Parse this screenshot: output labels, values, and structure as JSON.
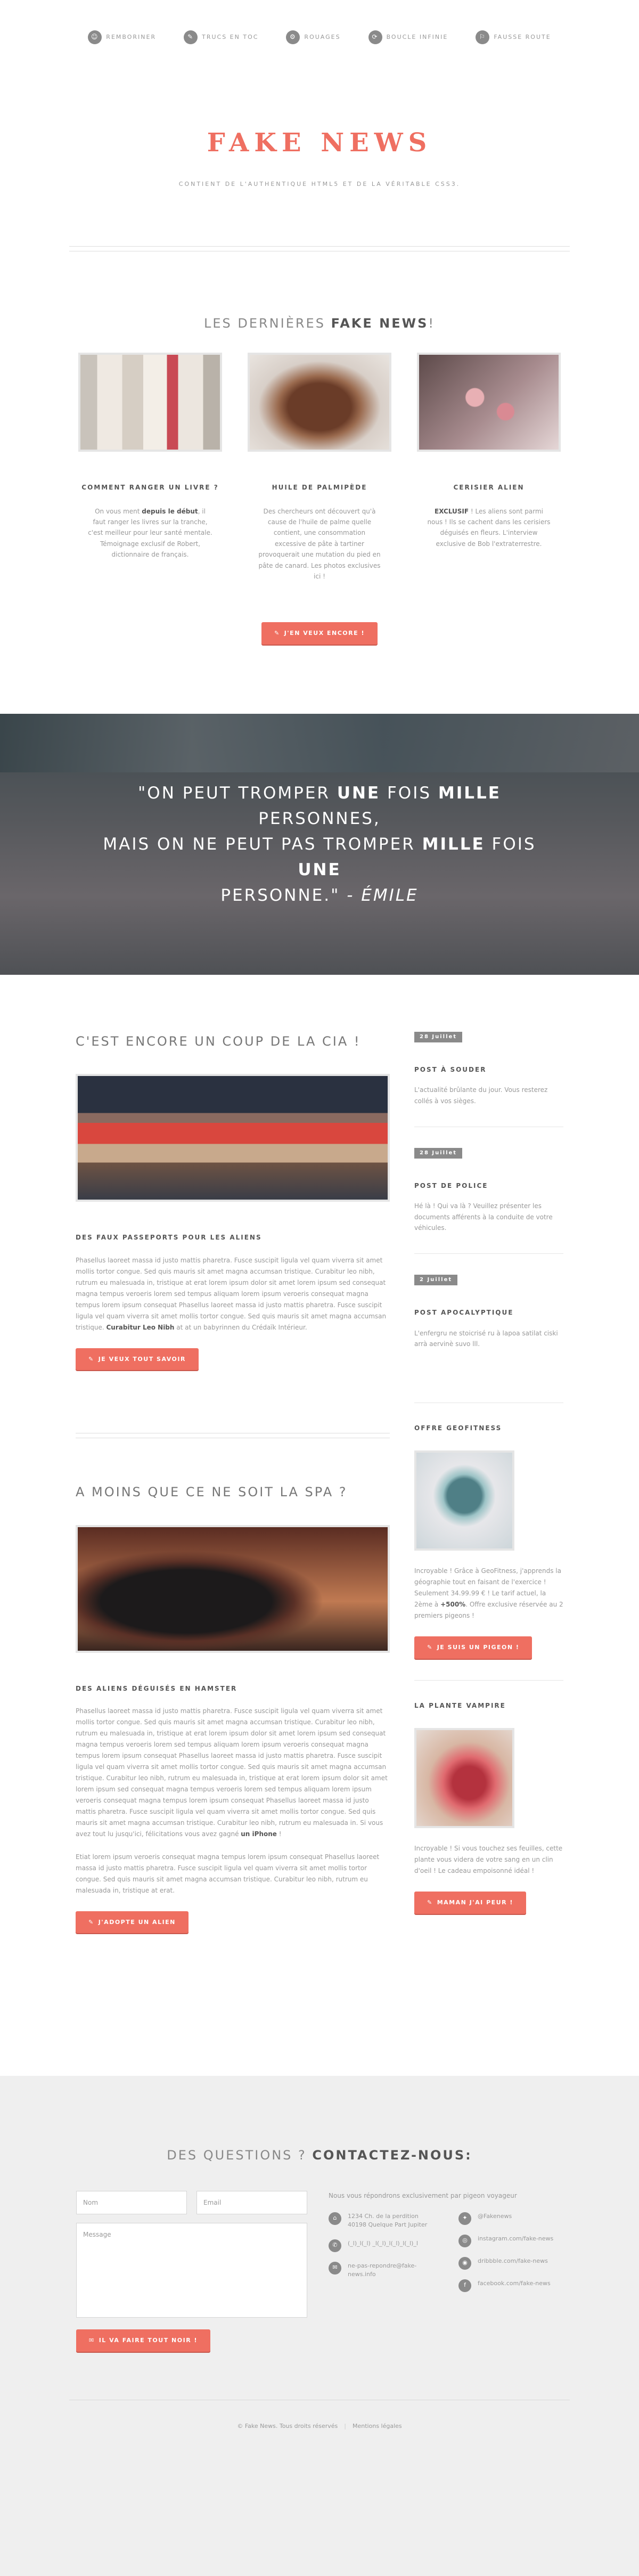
{
  "nav": {
    "items": [
      {
        "label": "Remboriner",
        "icon": "☺"
      },
      {
        "label": "Trucs en toc",
        "icon": "✎"
      },
      {
        "label": "Rouages",
        "icon": "⚙"
      },
      {
        "label": "Boucle infinie",
        "icon": "⟳"
      },
      {
        "label": "Fausse route",
        "icon": "⚐"
      }
    ]
  },
  "hero": {
    "title": "FAKE NEWS",
    "subtitle": "Contient de l'authentique HTML5 et de la véritable CSS3."
  },
  "news": {
    "title_a": "Les dernières",
    "title_b": "Fake News",
    "title_c": "!",
    "cards": [
      {
        "title": "Comment ranger un livre ?",
        "text_a": "On vous ment ",
        "text_b": "depuis le début",
        "text_c": ", il faut ranger les livres sur la tranche, c'est meilleur pour leur santé mentale. Témoignage exclusif de Robert, dictionnaire de français."
      },
      {
        "title": "Huile de palmipède",
        "text_a": "Des chercheurs ont découvert qu'à cause de l'huile de palme quelle contient, une consommation excessive de pâte à tartiner provoquerait une mutation du pied en pâte de canard. Les photos exclusives ici !",
        "text_b": "",
        "text_c": ""
      },
      {
        "title": "Cerisier alien",
        "text_a": "",
        "text_b": "EXCLUSIF",
        "text_c": " ! Les aliens sont parmi nous ! Ils se cachent dans les cerisiers déguisés en fleurs. L'interview exclusive de Bob l'extraterrestre."
      }
    ],
    "button": "J'en veux encore !",
    "button_icon": "✎"
  },
  "quote": {
    "l1a": "\"On peut tromper ",
    "l1b": "une",
    "l1c": " fois ",
    "l1d": "mille",
    "l1e": " personnes,",
    "l2a": "mais on ne peut pas tromper ",
    "l2b": "mille",
    "l2c": " fois ",
    "l2d": "une",
    "l3a": "personne.\"",
    "l3b": " - Émile"
  },
  "article1": {
    "title": "C'est encore un coup de la CIA !",
    "subhead": "Des faux passeports pour les aliens",
    "body_a": "Phasellus laoreet massa id justo mattis pharetra. Fusce suscipit ligula vel quam viverra sit amet mollis tortor congue. Sed quis mauris sit amet magna accumsan tristique. Curabitur leo nibh, rutrum eu malesuada in, tristique at erat lorem ipsum dolor sit amet lorem ipsum sed consequat magna tempus veroeris lorem sed tempus aliquam lorem ipsum veroeris consequat magna tempus lorem ipsum consequat Phasellus laoreet massa id justo mattis pharetra. Fusce suscipit ligula vel quam viverra sit amet mollis tortor congue. Sed quis mauris sit amet magna accumsan tristique. ",
    "body_b": "Curabitur Leo Nibh",
    "body_c": " at at un babyrinnen du Crédaïk Intérieur.",
    "button": "Je veux tout savoir",
    "button_icon": "✎"
  },
  "article2": {
    "title": "A moins que ce ne soit la SPA ?",
    "subhead": "Des aliens déguisés en hamster",
    "body_a": "Phasellus laoreet massa id justo mattis pharetra. Fusce suscipit ligula vel quam viverra sit amet mollis tortor congue. Sed quis mauris sit amet magna accumsan tristique. Curabitur leo nibh, rutrum eu malesuada in, tristique at erat lorem ipsum dolor sit amet lorem ipsum sed consequat magna tempus veroeris lorem sed tempus aliquam lorem ipsum veroeris consequat magna tempus lorem ipsum consequat Phasellus laoreet massa id justo mattis pharetra. Fusce suscipit ligula vel quam viverra sit amet mollis tortor congue. Sed quis mauris sit amet magna accumsan tristique. Curabitur leo nibh, rutrum eu malesuada in, tristique at erat lorem ipsum dolor sit amet lorem ipsum sed consequat magna tempus veroeris lorem sed tempus aliquam lorem ipsum veroeris consequat magna tempus lorem ipsum consequat Phasellus laoreet massa id justo mattis pharetra. Fusce suscipit ligula vel quam viverra sit amet mollis tortor congue. Sed quis mauris sit amet magna accumsan tristique. Curabitur leo nibh, rutrum eu malesuada in. Si vous avez tout lu jusqu'ici, félicitations vous avez gagné ",
    "body_b": "un iPhone",
    "body_c": " !",
    "body2": "Etiat lorem ipsum veroeris consequat magna tempus lorem ipsum consequat Phasellus laoreet massa id justo mattis pharetra. Fusce suscipit ligula vel quam viverra sit amet mollis tortor congue. Sed quis mauris sit amet magna accumsan tristique. Curabitur leo nibh, rutrum eu malesuada in, tristique at erat.",
    "button": "J'adopte un alien",
    "button_icon": "✎"
  },
  "sidebar": {
    "posts": [
      {
        "date": "28 Juillet",
        "title": "Post à souder",
        "text": "L'actualité brûlante du jour. Vous resterez collés à vos sièges."
      },
      {
        "date": "28 Juillet",
        "title": "Post de police",
        "text": "Hé là ! Qui va là ? Veuillez présenter les documents afférents à la conduite de votre véhicules."
      },
      {
        "date": "2 Juillet",
        "title": "Post apocalyptique",
        "text": "L'enfergru ne stoicrisé ru à lapoa satilat ciski arrà aervinè suvo lll."
      }
    ],
    "offer1": {
      "title": "Offre GeoFitness",
      "text_a": "Incroyable ! Grâce à GeoFitness, j'apprends la géographie tout en faisant de l'exercice ! Seulement 34.99.99 € ! Le tarif actuel, la 2ème à ",
      "text_b": "+500%",
      "text_c": ". Offre exclusive réservée au 2 premiers pigeons !",
      "button": "Je suis un pigeon !",
      "button_icon": "✎"
    },
    "offer2": {
      "title": "La plante vampire",
      "text": "Incroyable ! Si vous touchez ses feuilles, cette plante vous videra de votre sang en un clin d'oeil ! Le cadeau empoisonné idéal !",
      "button": "Maman j'ai peur !",
      "button_icon": "✎"
    }
  },
  "contact": {
    "title_a": "Des questions ?",
    "title_b": "Contactez-nous:",
    "name_placeholder": "Nom",
    "email_placeholder": "Email",
    "message_placeholder": "Message",
    "button": "Il va faire tout noir !",
    "button_icon": "✉",
    "intro": "Nous vous répondrons exclusivement par pigeon voyageur",
    "info_left": [
      {
        "icon": "⌂",
        "text": "1234 Ch. de la perdition 40198 Quelque Part Jupiter"
      },
      {
        "icon": "✆",
        "text": "(_l)_l(_l) _l(_l)_l(_l)_l(_l)_l"
      },
      {
        "icon": "✉",
        "text": "ne-pas-repondre@fake-news.info"
      }
    ],
    "info_right": [
      {
        "icon": "✦",
        "text": "@Fakenews"
      },
      {
        "icon": "◎",
        "text": "instagram.com/fake-news"
      },
      {
        "icon": "◉",
        "text": "dribbble.com/fake-news"
      },
      {
        "icon": "f",
        "text": "facebook.com/fake-news"
      }
    ]
  },
  "footer": {
    "copyright": "© Fake News. Tous droits réservés",
    "separator": "|",
    "legal": "Mentions légales"
  }
}
